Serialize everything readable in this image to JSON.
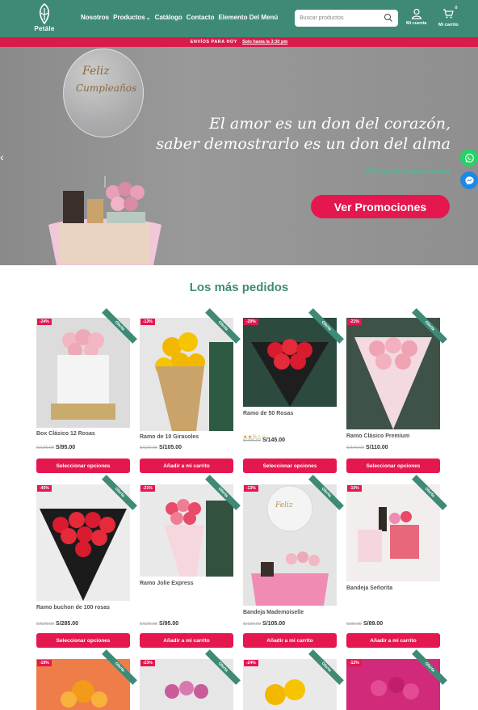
{
  "header": {
    "logo_text": "Petále",
    "nav": [
      {
        "label": "Nosotros"
      },
      {
        "label": "Productos",
        "dropdown": true
      },
      {
        "label": "Catálogo"
      },
      {
        "label": "Contacto"
      },
      {
        "label": "Elemento Del Menú"
      }
    ],
    "search": {
      "placeholder": "Buscar productos",
      "icon": "search-icon"
    },
    "account_label": "Mi cuenta",
    "cart_label": "Mi carrito",
    "cart_count": "0"
  },
  "promo": {
    "text": "ENVÍOS PARA HOY",
    "link": "Solo hasta la 3:30 pm"
  },
  "hero": {
    "line1": "El amor es un don del corazón,",
    "line2": "saber demostrarlo es un don del alma",
    "hashtag": "#Sorprendeconamor",
    "cta": "Ver Promociones",
    "balloon_line1": "Feliz",
    "balloon_line2": "Cumpleaños"
  },
  "section_title": "Los más pedidos",
  "products": [
    {
      "name": "Box Clásico 12 Rosas",
      "old_price": "S/125.00",
      "price": "S/95.00",
      "discount": "-24%",
      "badge": "Oferta",
      "button": "Seleccionar opciones",
      "rating": null,
      "img": "pink"
    },
    {
      "name": "Ramo de 10 Girasoles",
      "old_price": "S/120.00",
      "price": "S/105.00",
      "discount": "-13%",
      "badge": "Oferta",
      "button": "Añadir a mi carrito",
      "rating": null,
      "img": "sunflower"
    },
    {
      "name": "Ramo de 50 Rosas",
      "old_price": "S/205.00",
      "price": "S/145.00",
      "discount": "-29%",
      "badge": "Oferta",
      "button": "Seleccionar opciones",
      "rating": 2.5,
      "img": "red"
    },
    {
      "name": "Ramo Clásico Premium",
      "old_price": "S/140.00",
      "price": "S/110.00",
      "discount": "-21%",
      "badge": "Oferta",
      "button": "Seleccionar opciones",
      "rating": null,
      "img": "pinkwrap"
    },
    {
      "name": "Ramo buchon de 100 rosas",
      "old_price": "S/520.00",
      "price": "S/285.00",
      "discount": "-45%",
      "badge": "Oferta",
      "button": "Seleccionar opciones",
      "rating": null,
      "img": "red2"
    },
    {
      "name": "Ramo Jolie Express",
      "old_price": "S/120.00",
      "price": "S/95.00",
      "discount": "-21%",
      "badge": "Oferta",
      "button": "Añadir a mi carrito",
      "rating": null,
      "img": "jolie"
    },
    {
      "name": "Bandeja Mademoiselle",
      "old_price": "S/120.00",
      "price": "S/105.00",
      "discount": "-13%",
      "badge": "Oferta",
      "button": "Añadir a mi carrito",
      "rating": null,
      "img": "tray"
    },
    {
      "name": "Bandeja Señorita",
      "old_price": "S/99.00",
      "price": "S/89.00",
      "discount": "-10%",
      "badge": "Oferta",
      "button": "Añadir a mi carrito",
      "rating": null,
      "img": "senorita"
    },
    {
      "name": "",
      "old_price": "",
      "price": "",
      "discount": "-19%",
      "badge": "Oferta",
      "button": "",
      "rating": null,
      "img": "orange"
    },
    {
      "name": "",
      "old_price": "",
      "price": "",
      "discount": "-23%",
      "badge": "Oferta",
      "button": "",
      "rating": null,
      "img": "tulip"
    },
    {
      "name": "",
      "old_price": "",
      "price": "",
      "discount": "-24%",
      "badge": "Oferta",
      "button": "",
      "rating": null,
      "img": "sunflower2"
    },
    {
      "name": "",
      "old_price": "",
      "price": "",
      "discount": "-12%",
      "badge": "Oferta",
      "button": "",
      "rating": null,
      "img": "magenta"
    }
  ],
  "colors": {
    "brand_green": "#3f8a76",
    "accent_pink": "#e5174f",
    "promo_red": "#d81b4a"
  }
}
